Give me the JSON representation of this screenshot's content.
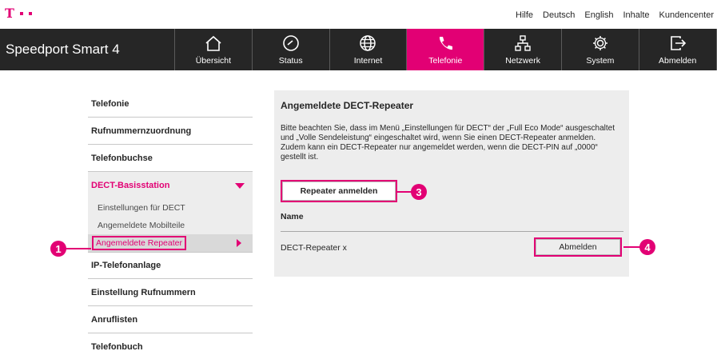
{
  "brand_color": "#e20074",
  "top_links": [
    "Hilfe",
    "Deutsch",
    "English",
    "Inhalte",
    "Kundencenter"
  ],
  "nav": {
    "product": "Speedport Smart 4",
    "items": [
      {
        "label": "Übersicht",
        "icon": "home-icon"
      },
      {
        "label": "Status",
        "icon": "gauge-icon"
      },
      {
        "label": "Internet",
        "icon": "globe-icon"
      },
      {
        "label": "Telefonie",
        "icon": "phone-icon",
        "active": true
      },
      {
        "label": "Netzwerk",
        "icon": "network-icon"
      },
      {
        "label": "System",
        "icon": "gear-icon"
      },
      {
        "label": "Abmelden",
        "icon": "logout-icon"
      }
    ]
  },
  "sidebar": {
    "items": [
      "Telefonie",
      "Rufnummernzuordnung",
      "Telefonbuchse"
    ],
    "expanded": {
      "label": "DECT-Basisstation",
      "subitems": [
        "Einstellungen für DECT",
        "Angemeldete Mobilteile",
        "Angemeldete Repeater"
      ]
    },
    "items_after": [
      "IP-Telefonanlage",
      "Einstellung Rufnummern",
      "Anruflisten",
      "Telefonbuch"
    ]
  },
  "main": {
    "title": "Angemeldete DECT-Repeater",
    "description": "Bitte beachten Sie, dass im Menü „Einstellungen für DECT“ der „Full Eco Mode“ ausgeschaltet und „Volle Sendeleistung“ eingeschaltet wird, wenn Sie einen DECT-Repeater anmelden. Zudem kann ein DECT-Repeater nur angemeldet werden, wenn die DECT-PIN auf „0000“ gestellt ist.",
    "add_button": "Repeater anmelden",
    "column_name": "Name",
    "rows": [
      {
        "name": "DECT-Repeater x",
        "action": "Abmelden"
      }
    ]
  },
  "callouts": [
    "1",
    "3",
    "4"
  ]
}
